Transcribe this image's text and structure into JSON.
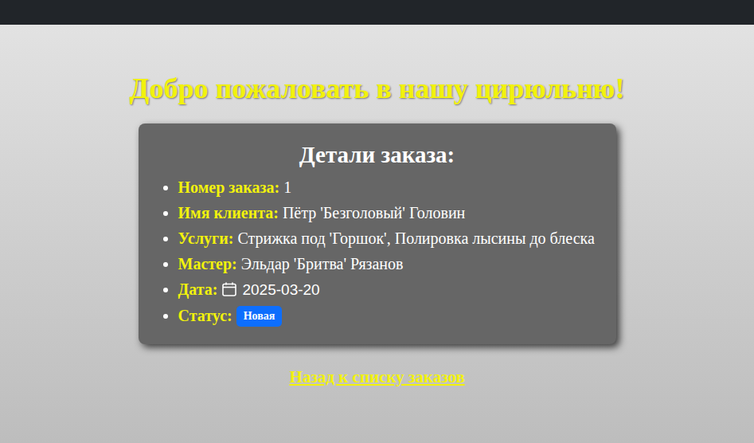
{
  "header": {
    "title": "Добро пожаловать в нашу цирюльню!"
  },
  "order": {
    "title": "Детали заказа:",
    "fields": [
      {
        "label": "Номер заказа:",
        "value": "1",
        "kind": "text"
      },
      {
        "label": "Имя клиента:",
        "value": "Пётр 'Безголовый' Головин",
        "kind": "text"
      },
      {
        "label": "Услуги:",
        "value": "Стрижка под 'Горшок', Полировка лысины до блеска",
        "kind": "text"
      },
      {
        "label": "Мастер:",
        "value": "Эльдар 'Бритва' Рязанов",
        "kind": "text"
      },
      {
        "label": "Дата:",
        "value": "2025-03-20",
        "kind": "date"
      },
      {
        "label": "Статус:",
        "value": "Новая",
        "kind": "badge"
      }
    ]
  },
  "back_link": "Назад к списку заказов"
}
